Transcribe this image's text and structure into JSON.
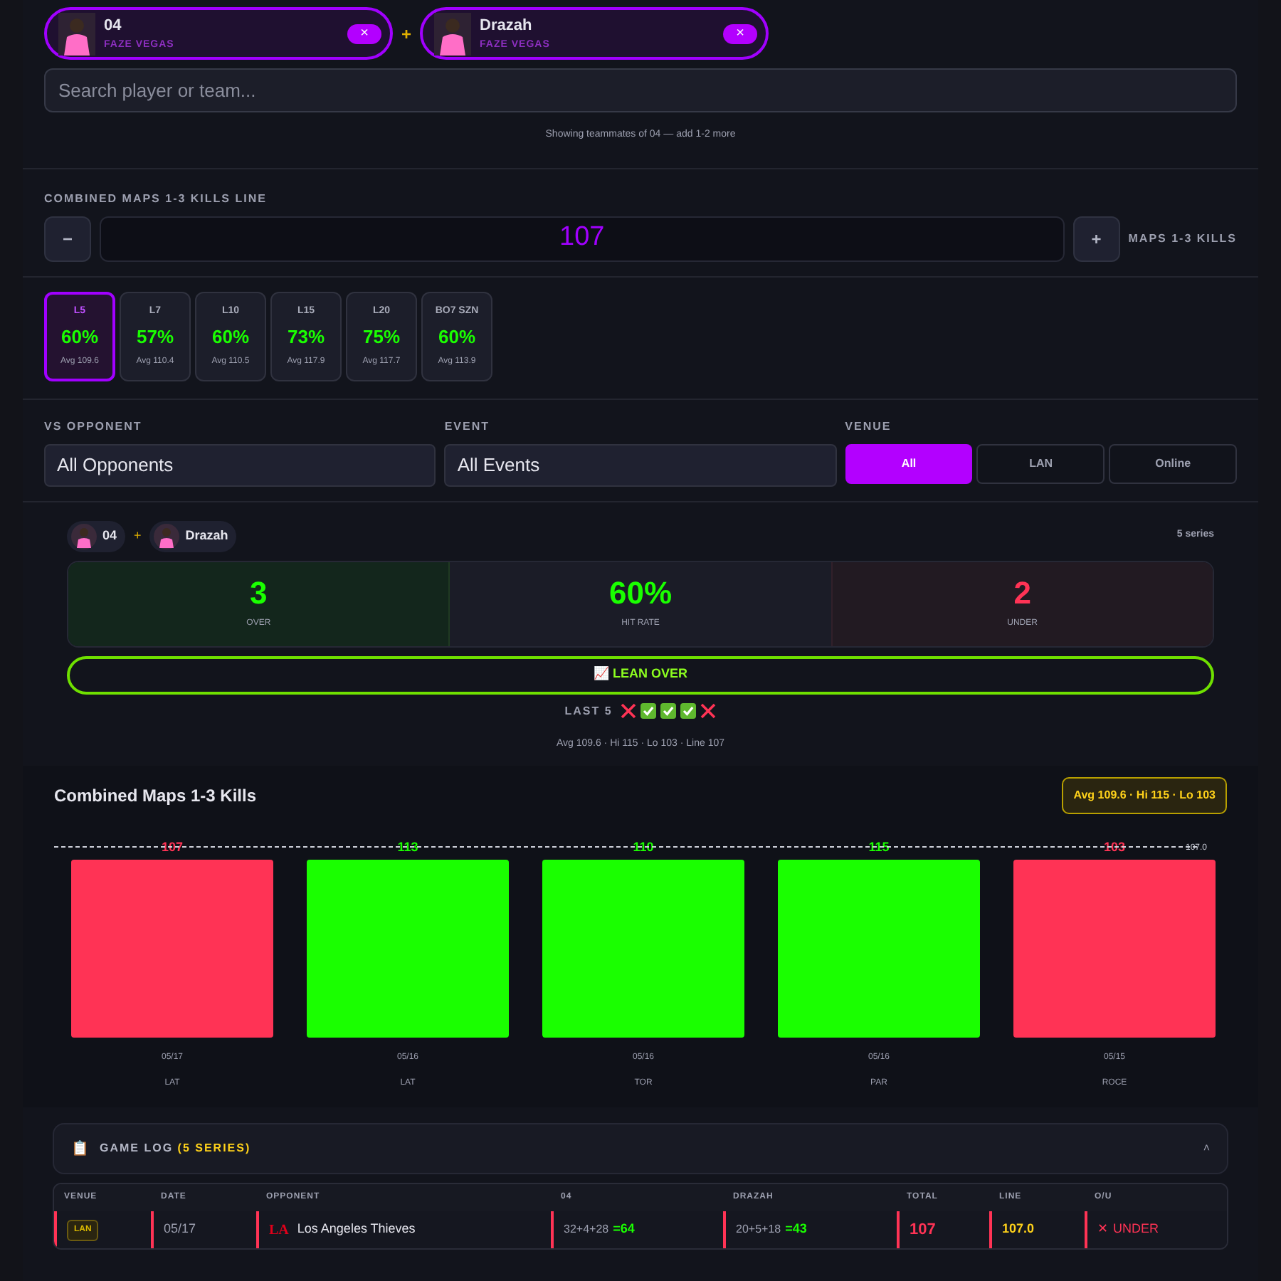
{
  "players": [
    {
      "name": "04",
      "team": "FAZE VEGAS",
      "remove": "×"
    },
    {
      "name": "Drazah",
      "team": "FAZE VEGAS",
      "remove": "×"
    }
  ],
  "joiner": "+",
  "search": {
    "placeholder": "Search player or team..."
  },
  "search_note": "Showing teammates of 04 — add 1-2 more",
  "line_control": {
    "label": "COMBINED MAPS 1-3 KILLS LINE",
    "minus": "−",
    "value": "107",
    "plus": "+",
    "unit": "MAPS 1-3 KILLS"
  },
  "ranges": [
    {
      "label": "L5",
      "pct": "60%",
      "avg": "Avg 109.6",
      "selected": true
    },
    {
      "label": "L7",
      "pct": "57%",
      "avg": "Avg 110.4",
      "selected": false
    },
    {
      "label": "L10",
      "pct": "60%",
      "avg": "Avg 110.5",
      "selected": false
    },
    {
      "label": "L15",
      "pct": "73%",
      "avg": "Avg 117.9",
      "selected": false
    },
    {
      "label": "L20",
      "pct": "75%",
      "avg": "Avg 117.7",
      "selected": false
    },
    {
      "label": "BO7 SZN",
      "pct": "60%",
      "avg": "Avg 113.9",
      "selected": false
    }
  ],
  "filters": {
    "opponent": {
      "label": "VS OPPONENT",
      "value": "All Opponents"
    },
    "event": {
      "label": "EVENT",
      "value": "All Events"
    },
    "venue": {
      "label": "VENUE",
      "options": [
        {
          "label": "All",
          "selected": true
        },
        {
          "label": "LAN",
          "selected": false
        },
        {
          "label": "Online",
          "selected": false
        }
      ]
    }
  },
  "pair": {
    "players": [
      "04",
      "Drazah"
    ],
    "joiner": "+",
    "count": "5 series"
  },
  "summary": [
    {
      "kind": "over",
      "value": "3",
      "label": "OVER"
    },
    {
      "kind": "rate",
      "value": "60%",
      "label": "HIT RATE"
    },
    {
      "kind": "under",
      "value": "2",
      "label": "UNDER"
    }
  ],
  "lean": {
    "icon": "📈",
    "label": "LEAN OVER"
  },
  "last5": {
    "label": "LAST 5",
    "results": [
      {
        "hit": false
      },
      {
        "hit": true
      },
      {
        "hit": true
      },
      {
        "hit": true
      },
      {
        "hit": false
      }
    ]
  },
  "stats_line": "Avg 109.6 · Hi 115 · Lo 103 · Line 107",
  "chart": {
    "title": "Combined Maps 1-3 Kills",
    "badge": "Avg 109.6 · Hi 115 · Lo 103",
    "line_label": "107.0",
    "bars": [
      {
        "value": "107",
        "date": "05/17",
        "opponent": "LAT",
        "over": false
      },
      {
        "value": "113",
        "date": "05/16",
        "opponent": "LAT",
        "over": true
      },
      {
        "value": "110",
        "date": "05/16",
        "opponent": "TOR",
        "over": true
      },
      {
        "value": "115",
        "date": "05/16",
        "opponent": "PAR",
        "over": true
      },
      {
        "value": "103",
        "date": "05/15",
        "opponent": "ROCE",
        "over": false
      }
    ]
  },
  "game_log": {
    "icon": "📋",
    "title": "GAME LOG",
    "count": "(5 SERIES)",
    "expanded": true,
    "toggle": "˄",
    "columns": [
      "VENUE",
      "DATE",
      "OPPONENT",
      "04",
      "DRAZAH",
      "TOTAL",
      "LINE",
      "O/U"
    ],
    "rows": [
      {
        "venue": "LAN",
        "date": "05/17",
        "logo": "LA",
        "opponent": "Los Angeles Thieves",
        "p1_maps": "32+4+28",
        "p1_total": "=64",
        "p2_maps": "20+5+18",
        "p2_total": "=43",
        "total": "107",
        "line": "107.0",
        "ou_icon": "✕",
        "ou": "UNDER",
        "over": false
      }
    ]
  }
}
